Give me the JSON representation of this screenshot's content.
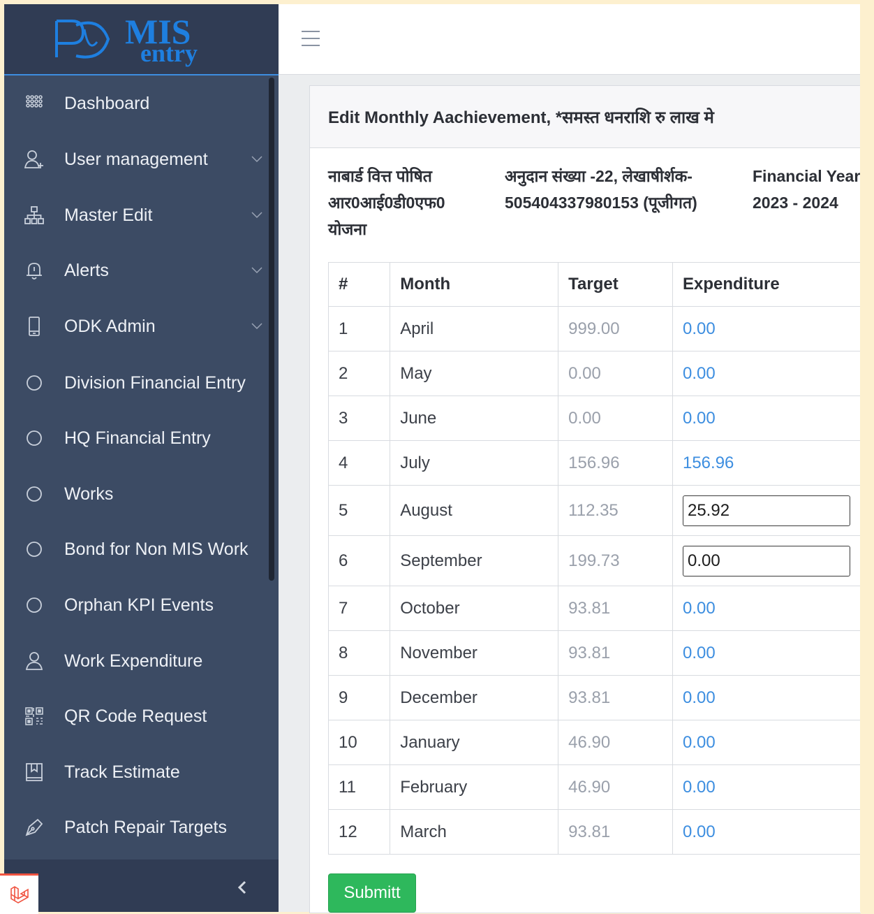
{
  "brand": {
    "logo_text": "MIS",
    "logo_sub": "entry"
  },
  "sidebar": {
    "items": [
      {
        "label": "Dashboard",
        "icon": "grid-icon",
        "chevron": false
      },
      {
        "label": "User management",
        "icon": "user-plus-icon",
        "chevron": true
      },
      {
        "label": "Master Edit",
        "icon": "sitemap-icon",
        "chevron": true
      },
      {
        "label": "Alerts",
        "icon": "bell-icon",
        "chevron": true
      },
      {
        "label": "ODK Admin",
        "icon": "mobile-icon",
        "chevron": true
      },
      {
        "label": "Division Financial Entry",
        "icon": "circle-icon",
        "chevron": false
      },
      {
        "label": "HQ Financial Entry",
        "icon": "circle-icon",
        "chevron": false
      },
      {
        "label": "Works",
        "icon": "circle-icon",
        "chevron": false
      },
      {
        "label": "Bond for Non MIS Work",
        "icon": "circle-icon",
        "chevron": false
      },
      {
        "label": "Orphan KPI Events",
        "icon": "circle-icon",
        "chevron": false
      },
      {
        "label": "Work Expenditure",
        "icon": "user-icon",
        "chevron": false
      },
      {
        "label": "QR Code Request",
        "icon": "qr-code-icon",
        "chevron": false
      },
      {
        "label": "Track Estimate",
        "icon": "book-icon",
        "chevron": false
      },
      {
        "label": "Patch Repair Targets",
        "icon": "pen-icon",
        "chevron": false
      }
    ],
    "toggle_icon": "chevron-left-icon"
  },
  "header": {
    "menu_icon": "hamburger-icon"
  },
  "card": {
    "title": "Edit Monthly Aachievement, *समस्त धनराशि रु लाख मे",
    "scheme_line1": "नाबार्ड वित्त पोषित",
    "scheme_line2": "आर0आई0डी0एफ0",
    "scheme_line3": "योजना",
    "grant_line1": "अनुदान संख्या -22, लेखाषीर्शक-",
    "grant_line2": "505404337980153 (पूजीगत)",
    "fy_label": "Financial Year",
    "fy_value": "2023 - 2024"
  },
  "table": {
    "headers": [
      "#",
      "Month",
      "Target",
      "Expenditure"
    ],
    "rows": [
      {
        "n": "1",
        "month": "April",
        "target": "999.00",
        "expenditure": "0.00",
        "editable": false
      },
      {
        "n": "2",
        "month": "May",
        "target": "0.00",
        "expenditure": "0.00",
        "editable": false
      },
      {
        "n": "3",
        "month": "June",
        "target": "0.00",
        "expenditure": "0.00",
        "editable": false
      },
      {
        "n": "4",
        "month": "July",
        "target": "156.96",
        "expenditure": "156.96",
        "editable": false
      },
      {
        "n": "5",
        "month": "August",
        "target": "112.35",
        "expenditure": "25.92",
        "editable": true
      },
      {
        "n": "6",
        "month": "September",
        "target": "199.73",
        "expenditure": "0.00",
        "editable": true
      },
      {
        "n": "7",
        "month": "October",
        "target": "93.81",
        "expenditure": "0.00",
        "editable": false
      },
      {
        "n": "8",
        "month": "November",
        "target": "93.81",
        "expenditure": "0.00",
        "editable": false
      },
      {
        "n": "9",
        "month": "December",
        "target": "93.81",
        "expenditure": "0.00",
        "editable": false
      },
      {
        "n": "10",
        "month": "January",
        "target": "46.90",
        "expenditure": "0.00",
        "editable": false
      },
      {
        "n": "11",
        "month": "February",
        "target": "46.90",
        "expenditure": "0.00",
        "editable": false
      },
      {
        "n": "12",
        "month": "March",
        "target": "93.81",
        "expenditure": "0.00",
        "editable": false
      }
    ]
  },
  "submit_label": "Submitt",
  "colors": {
    "sidebar": "#3c4b64",
    "accent": "#3d8ee0",
    "submit": "#2eb85c"
  }
}
